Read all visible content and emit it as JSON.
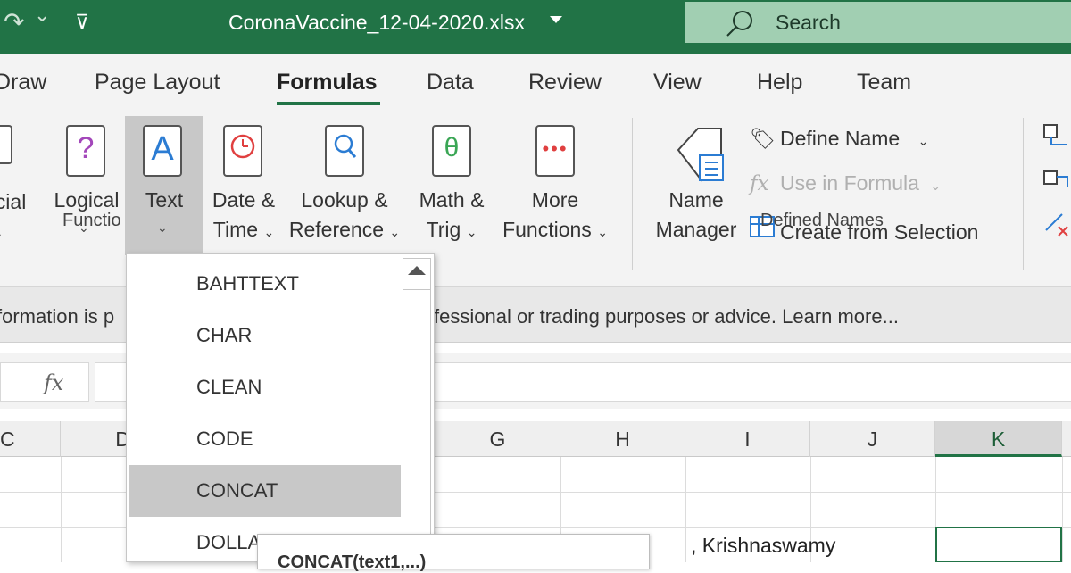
{
  "titlebar": {
    "file_name": "CoronaVaccine_12-04-2020.xlsx",
    "search_label": "Search",
    "redo_glyph": "↷",
    "chevron_glyph": "⌄",
    "qat_glyph": "⊽"
  },
  "tabs": [
    "Draw",
    "Page Layout",
    "Formulas",
    "Data",
    "Review",
    "View",
    "Help",
    "Team"
  ],
  "ribbon": {
    "function_library": {
      "label": "Functio",
      "buttons": [
        {
          "line1": "ncial",
          "line2": "",
          "icon": "financial-book-icon"
        },
        {
          "line1": "Logical",
          "line2": "",
          "icon": "logical-book-icon",
          "glyph": "?"
        },
        {
          "line1": "Text",
          "line2": "",
          "icon": "text-book-icon",
          "glyph": "A"
        },
        {
          "line1": "Date &",
          "line2": "Time",
          "icon": "date-time-book-icon"
        },
        {
          "line1": "Lookup &",
          "line2": "Reference",
          "icon": "lookup-book-icon"
        },
        {
          "line1": "Math &",
          "line2": "Trig",
          "icon": "math-book-icon",
          "glyph": "θ"
        },
        {
          "line1": "More",
          "line2": "Functions",
          "icon": "more-functions-book-icon"
        }
      ]
    },
    "defined_names": {
      "label": "Defined Names",
      "name_manager": {
        "line1": "Name",
        "line2": "Manager"
      },
      "define_name": "Define Name",
      "use_in_formula": "Use in Formula",
      "create_from_selection": "Create from Selection"
    }
  },
  "infobar": {
    "left_text": "formation is p",
    "right_text": "fessional or trading purposes or advice. Learn more..."
  },
  "formula_bar": {
    "fx_label": "fx",
    "value": ""
  },
  "columns": [
    "C",
    "D",
    "G",
    "H",
    "I",
    "J",
    "K"
  ],
  "cells": {
    "row3_text": ", Krishnaswamy"
  },
  "dropdown": {
    "items": [
      "BAHTTEXT",
      "CHAR",
      "CLEAN",
      "CODE",
      "CONCAT",
      "DOLLA"
    ],
    "highlighted": "CONCAT"
  },
  "tooltip": {
    "text": "CONCAT(text1,...)"
  }
}
